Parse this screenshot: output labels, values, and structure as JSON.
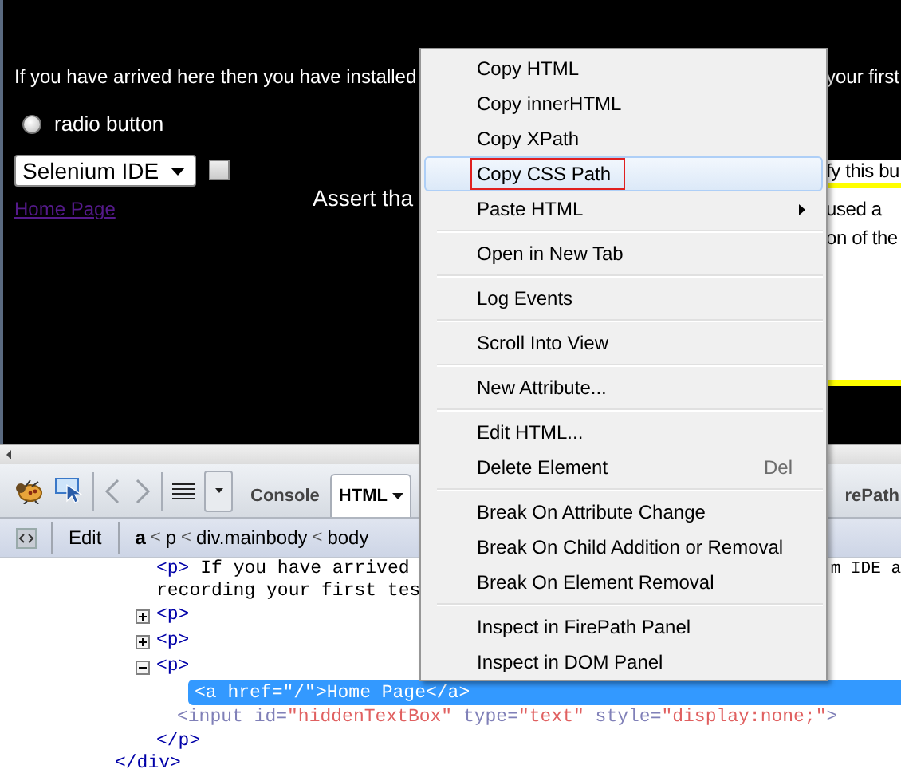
{
  "page": {
    "intro_text": "If you have arrived here then you have installed",
    "intro_tail": "your first",
    "radio": {
      "label": "radio button",
      "selected": false
    },
    "select": {
      "value": "Selenium IDE"
    },
    "checkbox": {
      "checked": false
    },
    "assert_text": "Assert tha",
    "link": "Home Page",
    "box_lines": [
      "fy this bu",
      "used a",
      "on of the"
    ]
  },
  "firebug": {
    "tabs": [
      {
        "label": "Console",
        "selected": false,
        "dropdown": false
      },
      {
        "label": "HTML",
        "selected": true,
        "dropdown": true
      },
      {
        "label": "rePath",
        "selected": false,
        "dropdown": false
      }
    ],
    "edit_button": "Edit",
    "separator": "<",
    "breadcrumbs": [
      {
        "label": "a",
        "selected": true
      },
      {
        "label": "p",
        "selected": false
      },
      {
        "label": "div.mainbody",
        "selected": false
      },
      {
        "label": "body",
        "selected": false
      }
    ],
    "tree": {
      "closing": [
        {
          "kind": "tag",
          "text": "</div>"
        }
      ],
      "children": [
        {
          "kind": "text-element",
          "selected": false,
          "tokens": [
            {
              "kind": "tag",
              "text": "<p>"
            },
            {
              "kind": "text",
              "text": " If you have arrived"
            }
          ],
          "tail": "m IDE a",
          "continuation": "recording your first tes"
        },
        {
          "kind": "element",
          "selected": false,
          "expanded": false,
          "tokens": [
            {
              "kind": "tag",
              "text": "<p>"
            }
          ]
        },
        {
          "kind": "element",
          "selected": false,
          "expanded": false,
          "tokens": [
            {
              "kind": "tag",
              "text": "<p>"
            }
          ]
        },
        {
          "kind": "element",
          "selected": false,
          "expanded": true,
          "tokens": [
            {
              "kind": "tag",
              "text": "<p>"
            }
          ],
          "closing": [
            {
              "kind": "tag",
              "text": "</p>"
            }
          ],
          "children": [
            {
              "kind": "leaf",
              "selected": true,
              "hidden": false,
              "tokens": [
                {
                  "kind": "tag",
                  "text": "<a"
                },
                {
                  "kind": "attr",
                  "text": " href="
                },
                {
                  "kind": "value",
                  "text": "\"/\""
                },
                {
                  "kind": "tag",
                  "text": ">"
                },
                {
                  "kind": "text",
                  "text": "Home Page"
                },
                {
                  "kind": "tag",
                  "text": "</a>"
                }
              ]
            },
            {
              "kind": "leaf",
              "selected": false,
              "hidden": true,
              "tokens": [
                {
                  "kind": "tag",
                  "text": "<input"
                },
                {
                  "kind": "attr",
                  "text": " id="
                },
                {
                  "kind": "value",
                  "text": "\"hiddenTextBox\""
                },
                {
                  "kind": "attr",
                  "text": " type="
                },
                {
                  "kind": "value",
                  "text": "\"text\""
                },
                {
                  "kind": "attr",
                  "text": " style="
                },
                {
                  "kind": "value",
                  "text": "\"display:none;\""
                },
                {
                  "kind": "tag",
                  "text": ">"
                }
              ]
            }
          ]
        }
      ]
    }
  },
  "context_menu": {
    "items": [
      {
        "kind": "item",
        "label": "Copy HTML",
        "selected": false
      },
      {
        "kind": "item",
        "label": "Copy innerHTML",
        "selected": false
      },
      {
        "kind": "item",
        "label": "Copy XPath",
        "selected": false
      },
      {
        "kind": "item",
        "label": "Copy CSS Path",
        "selected": true
      },
      {
        "kind": "item",
        "label": "Paste HTML",
        "selected": false,
        "submenu": true
      },
      {
        "kind": "separator"
      },
      {
        "kind": "item",
        "label": "Open in New Tab",
        "selected": false
      },
      {
        "kind": "separator"
      },
      {
        "kind": "item",
        "label": "Log Events",
        "selected": false
      },
      {
        "kind": "separator"
      },
      {
        "kind": "item",
        "label": "Scroll Into View",
        "selected": false
      },
      {
        "kind": "separator"
      },
      {
        "kind": "item",
        "label": "New Attribute...",
        "selected": false
      },
      {
        "kind": "separator"
      },
      {
        "kind": "item",
        "label": "Edit HTML...",
        "selected": false
      },
      {
        "kind": "item",
        "label": "Delete Element",
        "selected": false,
        "shortcut": "Del"
      },
      {
        "kind": "separator"
      },
      {
        "kind": "item",
        "label": "Break On Attribute Change",
        "selected": false
      },
      {
        "kind": "item",
        "label": "Break On Child Addition or Removal",
        "selected": false
      },
      {
        "kind": "item",
        "label": "Break On Element Removal",
        "selected": false
      },
      {
        "kind": "separator"
      },
      {
        "kind": "item",
        "label": "Inspect in FirePath Panel",
        "selected": false
      },
      {
        "kind": "item",
        "label": "Inspect in DOM Panel",
        "selected": false
      }
    ]
  }
}
